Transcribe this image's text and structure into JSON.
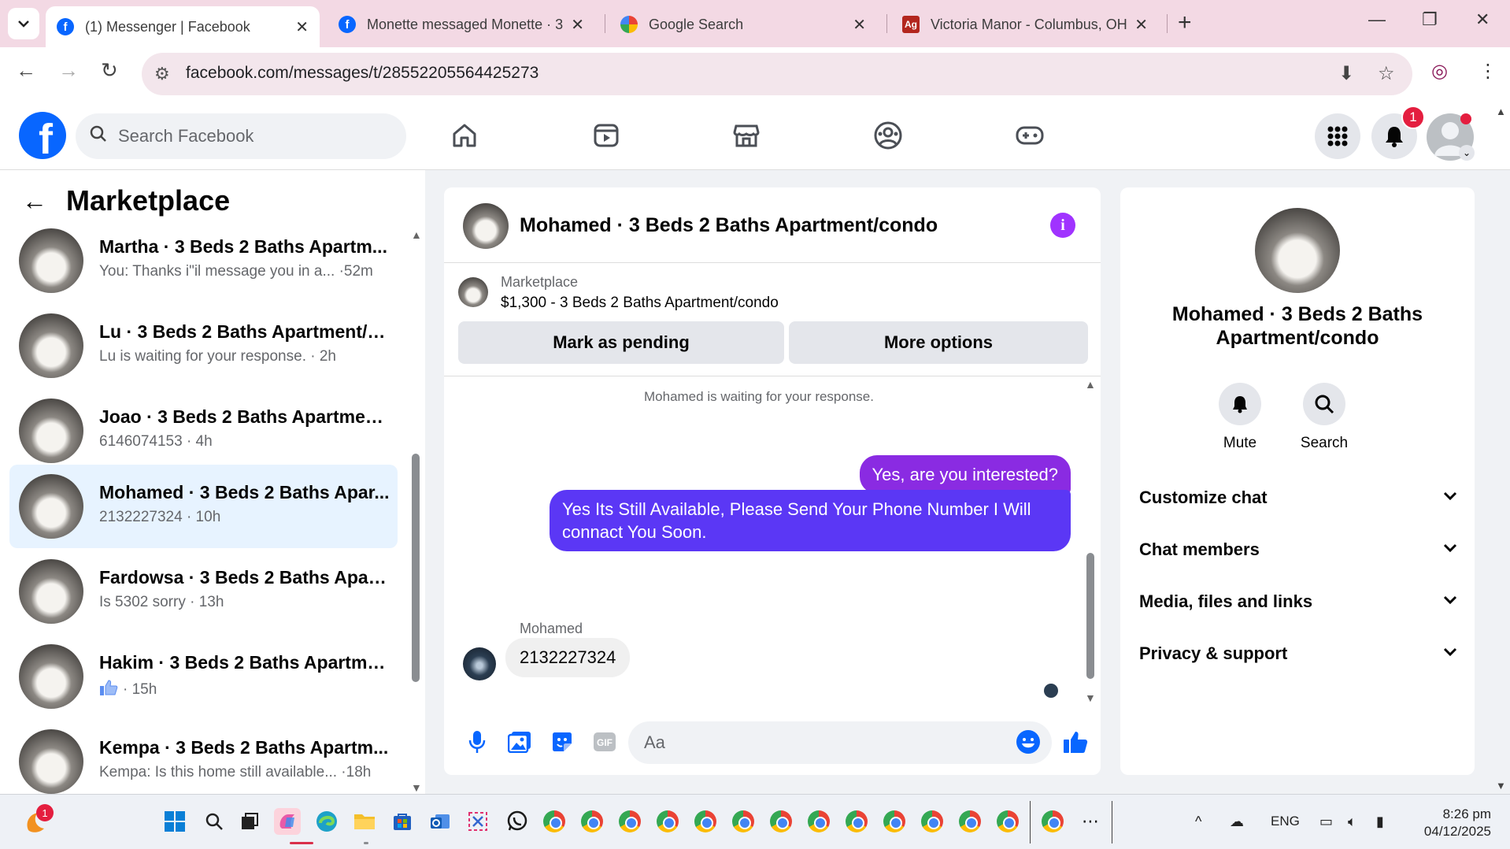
{
  "browser": {
    "tabs": [
      {
        "title": "(1) Messenger | Facebook",
        "active": true,
        "favicon": "facebook-icon"
      },
      {
        "title": "Monette messaged Monette · 3",
        "active": false,
        "favicon": "facebook-icon"
      },
      {
        "title": "Google Search",
        "active": false,
        "favicon": "google-icon"
      },
      {
        "title": "Victoria Manor - Columbus, OH",
        "active": false,
        "favicon": "ag-icon"
      }
    ],
    "url": "facebook.com/messages/t/28552205564425273"
  },
  "fb": {
    "search_placeholder": "Search Facebook",
    "notification_count": "1"
  },
  "left": {
    "title": "Marketplace",
    "conversations": [
      {
        "name": "Martha · 3 Beds 2 Baths Apartm...",
        "sub": "You: Thanks i\"il message you in a... ·52m"
      },
      {
        "name": "Lu · 3 Beds 2 Baths Apartment/c...",
        "sub": "Lu is waiting for your response. · 2h"
      },
      {
        "name": "Joao · 3 Beds 2 Baths Apartment...",
        "sub": "6146074153 · 4h"
      },
      {
        "name": "Mohamed · 3 Beds 2 Baths Apar...",
        "sub": "2132227324 · 10h",
        "selected": true
      },
      {
        "name": "Fardowsa · 3 Beds 2 Baths Apart...",
        "sub": "Is 5302 sorry · 13h"
      },
      {
        "name": "Hakim · 3 Beds 2 Baths Apartme...",
        "sub": "· 15h"
      },
      {
        "name": "Kempa · 3 Beds 2 Baths Apartm...",
        "sub": "Kempa: Is this home still available... ·18h"
      }
    ]
  },
  "chat": {
    "title": "Mohamed · 3 Beds 2 Baths Apartment/condo",
    "listing_label": "Marketplace",
    "listing_price": "$1,300 - 3 Beds 2 Baths Apartment/condo",
    "mark_pending": "Mark as pending",
    "more_options": "More options",
    "waiting": "Mohamed is waiting for your response.",
    "out_messages": [
      "Yes, are you interested?",
      "Yes Its Still Available, Please Send Your Phone Number I Will connact You Soon."
    ],
    "sender": "Mohamed",
    "in_message": "2132227324",
    "composer_placeholder": "Aa"
  },
  "right": {
    "name": "Mohamed · 3 Beds 2 Baths Apartment/condo",
    "mute": "Mute",
    "search": "Search",
    "sections": [
      "Customize chat",
      "Chat members",
      "Media, files and links",
      "Privacy & support"
    ]
  },
  "taskbar": {
    "lang": "ENG",
    "time": "8:26 pm",
    "date": "04/12/2025",
    "weather_badge": "1"
  },
  "colors": {
    "fb_blue": "#0866ff",
    "outgoing_purple": "#8a2be2",
    "outgoing_blue": "#5b37f5",
    "selected_row": "#e7f3ff",
    "tabstrip": "#f3d9e4"
  }
}
